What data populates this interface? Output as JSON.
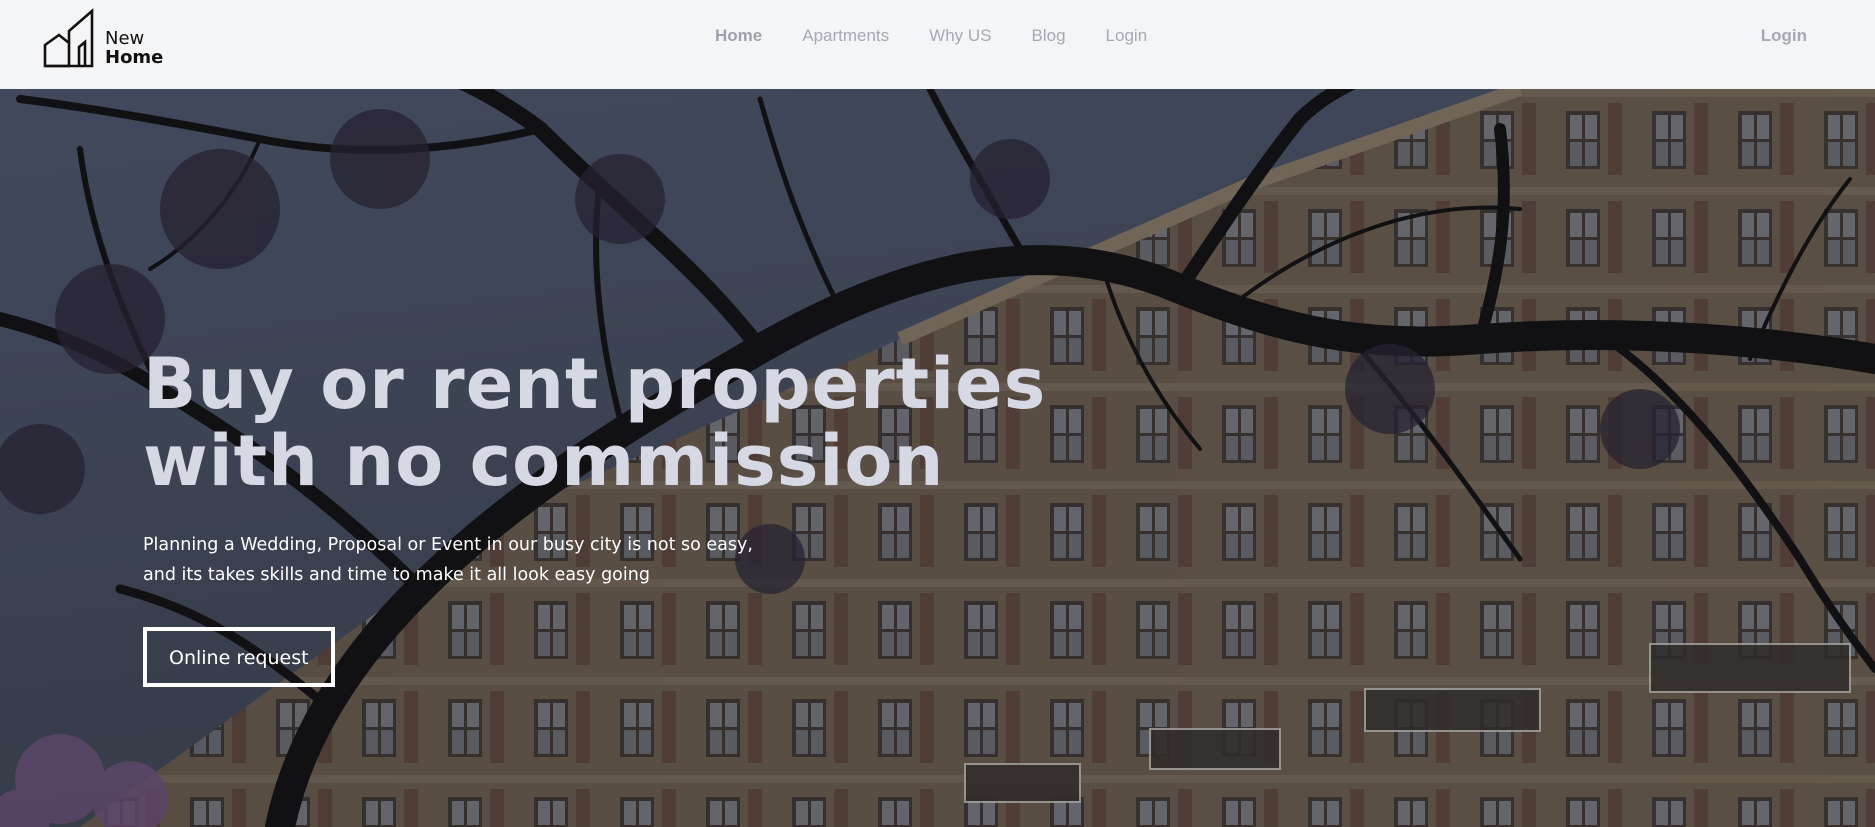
{
  "logo": {
    "line1": "New",
    "line2": "Home",
    "icon": "building-icon"
  },
  "nav": {
    "items": [
      {
        "label": "Home",
        "active": true
      },
      {
        "label": "Apartments"
      },
      {
        "label": "Why US"
      },
      {
        "label": "Blog"
      },
      {
        "label": "Login"
      }
    ],
    "login": "Login"
  },
  "hero": {
    "headline_line1": "Buy or rent properties",
    "headline_line2": "with no commission",
    "sub_line1": "Planning a Wedding, Proposal or Event in our busy city is not so easy,",
    "sub_line2": "and its takes skills and time to make it all look easy going",
    "cta": "Online request",
    "image": "building-with-tree-branches"
  },
  "colors": {
    "header_bg": "#f4f5f7",
    "nav_text": "#a4a9b3",
    "headline": "#d6d9e3",
    "overlay": "#1d1f26"
  }
}
